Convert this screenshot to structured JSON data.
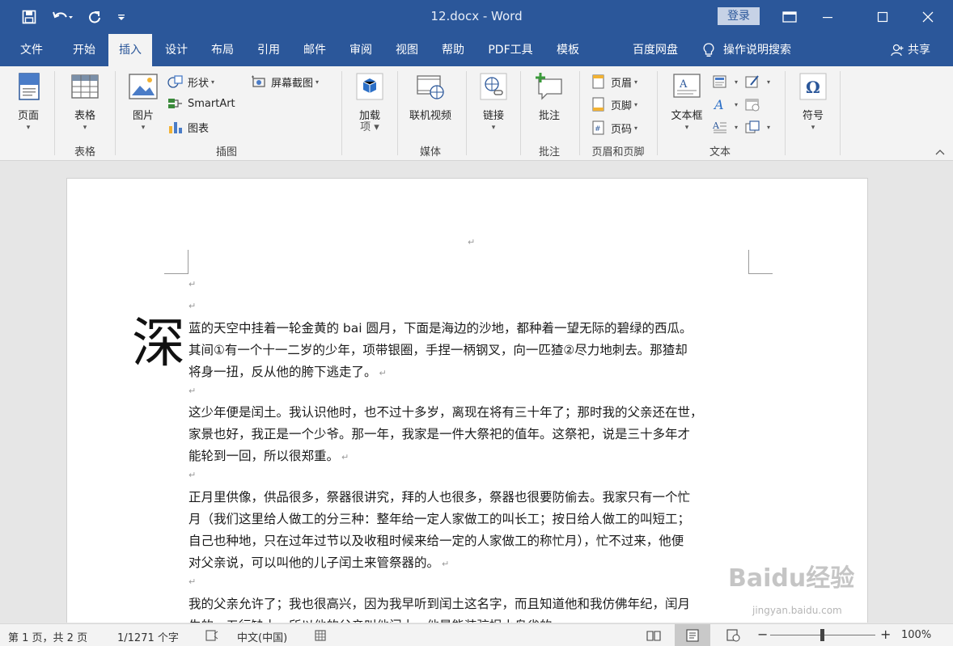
{
  "titlebar": {
    "title": "12.docx  -  Word",
    "login": "登录"
  },
  "tabs": [
    "文件",
    "开始",
    "插入",
    "设计",
    "布局",
    "引用",
    "邮件",
    "审阅",
    "视图",
    "帮助",
    "PDF工具",
    "模板",
    "百度网盘",
    "操作说明搜索",
    "共享"
  ],
  "ribbon": {
    "pages": "页面",
    "table": "表格",
    "group_table": "表格",
    "picture": "图片",
    "shapes": "形状",
    "smartart": "SmartArt",
    "chart": "图表",
    "screenshot": "屏幕截图",
    "group_illustrations": "插图",
    "addins": "加载",
    "addins2": "项",
    "online_video": "联机视频",
    "group_media": "媒体",
    "link": "链接",
    "comment": "批注",
    "group_comments": "批注",
    "header": "页眉",
    "footer": "页脚",
    "page_number": "页码",
    "group_header_footer": "页眉和页脚",
    "textbox": "文本框",
    "group_text": "文本",
    "symbol": "符号"
  },
  "document": {
    "dropcap": "深",
    "para1": [
      "蓝的天空中挂着一轮金黄的 bai 圆月，下面是海边的沙地，都种着一望无际的碧绿的西瓜。",
      "其间①有一个十一二岁的少年，项带银圈，手捏一柄钢叉，向一匹猹②尽力地刺去。那猹却",
      "将身一扭，反从他的胯下逃走了。"
    ],
    "para2": [
      "这少年便是闰土。我认识他时，也不过十多岁，离现在将有三十年了；那时我的父亲还在世，",
      "家景也好，我正是一个少爷。那一年，我家是一件大祭祀的值年。这祭祀，说是三十多年才",
      "能轮到一回，所以很郑重。"
    ],
    "para3": [
      "正月里供像，供品很多，祭器很讲究，拜的人也很多，祭器也很要防偷去。我家只有一个忙",
      "月（我们这里给人做工的分三种：整年给一定人家做工的叫长工；按日给人做工的叫短工；",
      "自己也种地，只在过年过节以及收租时候来给一定的人家做工的称忙月），忙不过来，他便",
      "对父亲说，可以叫他的儿子闰土来管祭器的。"
    ],
    "para4": [
      "我的父亲允许了；我也很高兴，因为我早听到闰土这名字，而且知道他和我仿佛年纪，闰月",
      "生的，五行缺土，所以他的父亲叫他闰土。他是能装弶捉小鸟雀的。"
    ],
    "para_mark": "↵"
  },
  "status": {
    "page": "第 1 页，共 2 页",
    "words": "1/1271 个字",
    "language": "中文(中国)",
    "zoom": "100%",
    "zoom_level": 1.0
  },
  "watermark": {
    "brand": "Baidu经验",
    "url": "jingyan.baidu.com"
  },
  "colors": {
    "accent": "#2b579a",
    "ribbon_bg": "#f3f3f3",
    "page_bg": "#ffffff"
  }
}
